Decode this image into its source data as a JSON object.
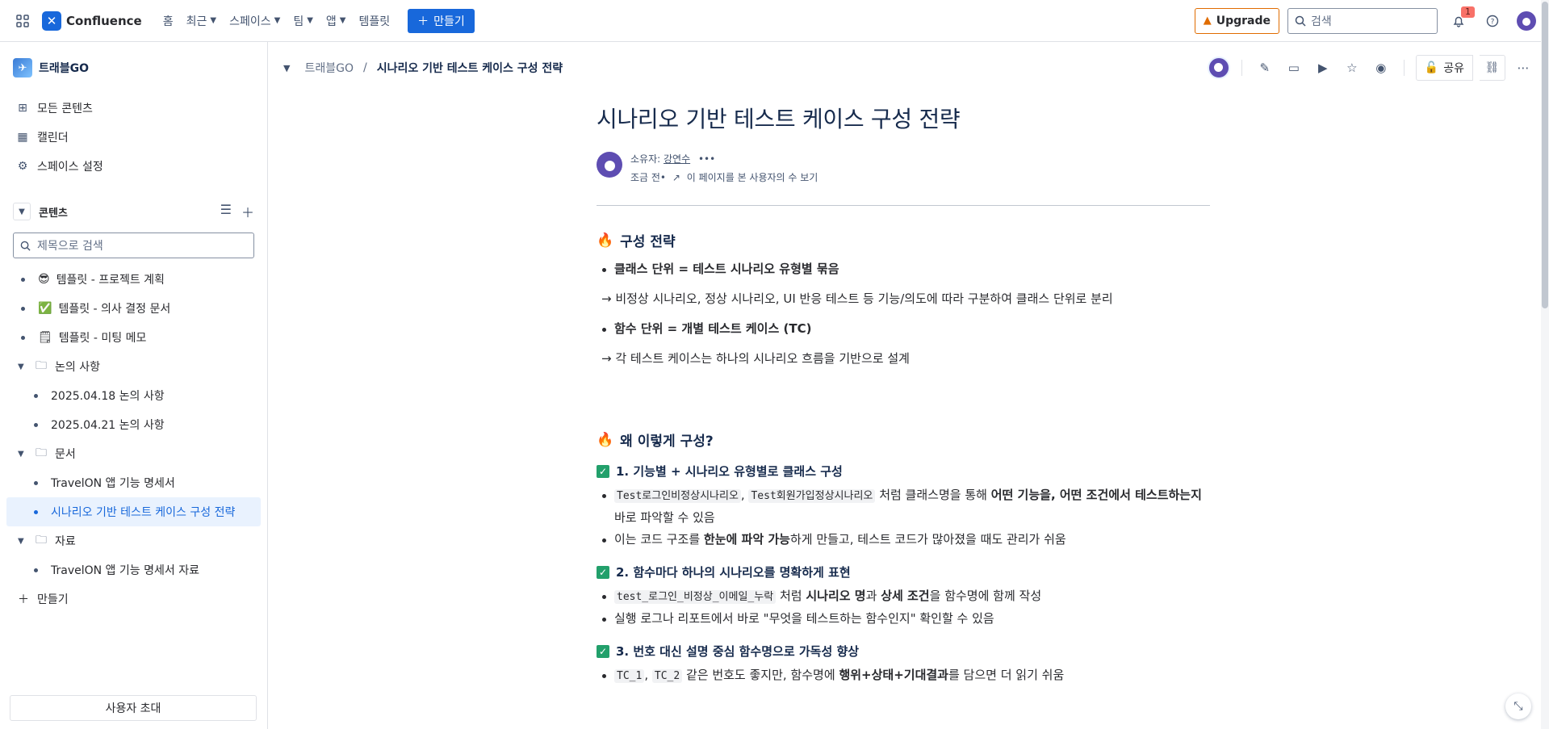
{
  "topbar": {
    "product": "Confluence",
    "nav": [
      "홈",
      "최근",
      "스페이스",
      "팀",
      "앱",
      "템플릿"
    ],
    "create_label": "만들기",
    "upgrade_label": "Upgrade",
    "search_placeholder": "검색",
    "notification_count": "1"
  },
  "sidebar": {
    "space_name": "트래블GO",
    "links": [
      "모든 콘텐츠",
      "캘린더",
      "스페이스 설정"
    ],
    "content_title": "콘텐츠",
    "search_placeholder": "제목으로 검색",
    "tree": {
      "t1": "템플릿 - 프로젝트 계획",
      "t2": "템플릿 - 의사 결정 문서",
      "t3": "템플릿 - 미팅 메모",
      "f1": "논의 사항",
      "f1a": "2025.04.18 논의 사항",
      "f1b": "2025.04.21 논의 사항",
      "f2": "문서",
      "f2a": "TravelON 앱 기능 명세서",
      "f2b": "시나리오 기반 테스트 케이스 구성 전략",
      "f3": "자료",
      "f3a": "TravelON 앱 기능 명세서 자료"
    },
    "create_label": "만들기",
    "invite_label": "사용자 초대"
  },
  "breadcrumb": {
    "space": "트래블GO",
    "sep": "/",
    "page": "시나리오 기반 테스트 케이스 구성 전략"
  },
  "actions": {
    "share_label": "공유"
  },
  "page": {
    "title": "시나리오 기반 테스트 케이스 구성 전략",
    "owner_label": "소유자:",
    "owner_name": "강연수",
    "time_label": "조금 전•",
    "viewers_label": "이 페이지를 본 사용자의 수 보기",
    "s1_title": "구성 전략",
    "s1_b1": "클래스 단위 = 테스트 시나리오 유형별 묶음",
    "s1_p1": "→ 비정상 시나리오, 정상 시나리오, UI 반응 테스트 등 기능/의도에 따라 구분하여 클래스 단위로 분리",
    "s1_b2": "함수 단위 = 개별 테스트 케이스 (TC)",
    "s1_p2": "→ 각 테스트 케이스는 하나의 시나리오 흐름을 기반으로 설계",
    "s2_title": "왜 이렇게 구성?",
    "h1": "1. 기능별 + 시나리오 유형별로 클래스 구성",
    "h1_code1": "Test로그인비정상시나리오",
    "h1_comma": ",",
    "h1_code2": "Test회원가입정상시나리오",
    "h1_t1": "처럼 클래스명을 통해",
    "h1_bold": "어떤 기능을, 어떤 조건에서 테스트하는지",
    "h1_t2": "바로 파악할 수 있음",
    "h1_b2_pre": "이는 코드 구조를",
    "h1_b2_bold": "한눈에 파악 가능",
    "h1_b2_post": "하게 만들고, 테스트 코드가 많아졌을 때도 관리가 쉬움",
    "h2": "2. 함수마다 하나의 시나리오를 명확하게 표현",
    "h2_code": "test_로그인_비정상_이메일_누락",
    "h2_t1": "처럼",
    "h2_bold1": "시나리오 명",
    "h2_t2": "과",
    "h2_bold2": "상세 조건",
    "h2_t3": "을 함수명에 함께 작성",
    "h2_b2": "실행 로그나 리포트에서 바로 \"무엇을 테스트하는 함수인지\" 확인할 수 있음",
    "h3": "3. 번호 대신 설명 중심 함수명으로 가독성 향상",
    "h3_code1": "TC_1",
    "h3_comma": ",",
    "h3_code2": "TC_2",
    "h3_t1": "같은 번호도 좋지만, 함수명에",
    "h3_bold": "행위+상태+기대결과",
    "h3_t2": "를 담으면 더 읽기 쉬움"
  },
  "colors": {
    "brand": "#1868db",
    "upgrade": "#e06c00",
    "check": "#22a06b",
    "fire": "#e56910",
    "active_bg": "#e9f2fe"
  }
}
